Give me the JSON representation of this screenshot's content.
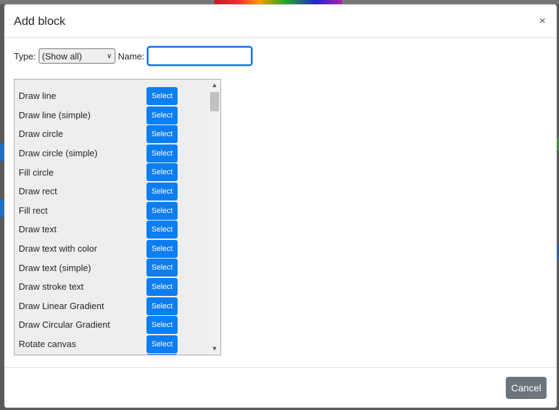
{
  "modal": {
    "title": "Add block",
    "close_icon": "close-icon",
    "close_glyph": "×"
  },
  "filter": {
    "type_label": "Type:",
    "type_selected": "(Show all)",
    "name_label": "Name:",
    "name_value": ""
  },
  "blocks": [
    {
      "label": "Draw line",
      "button": "Select"
    },
    {
      "label": "Draw line (simple)",
      "button": "Select"
    },
    {
      "label": "Draw circle",
      "button": "Select"
    },
    {
      "label": "Draw circle (simple)",
      "button": "Select"
    },
    {
      "label": "Fill circle",
      "button": "Select"
    },
    {
      "label": "Draw rect",
      "button": "Select"
    },
    {
      "label": "Fill rect",
      "button": "Select"
    },
    {
      "label": "Draw text",
      "button": "Select"
    },
    {
      "label": "Draw text with color",
      "button": "Select"
    },
    {
      "label": "Draw text (simple)",
      "button": "Select"
    },
    {
      "label": "Draw stroke text",
      "button": "Select"
    },
    {
      "label": "Draw Linear Gradient",
      "button": "Select"
    },
    {
      "label": "Draw Circular Gradient",
      "button": "Select"
    },
    {
      "label": "Rotate canvas",
      "button": "Select"
    },
    {
      "label": "",
      "button": ""
    }
  ],
  "footer": {
    "cancel_label": "Cancel"
  },
  "colors": {
    "primary": "#0d7ef0",
    "secondary": "#6c757d",
    "focus": "#1a73e8"
  }
}
